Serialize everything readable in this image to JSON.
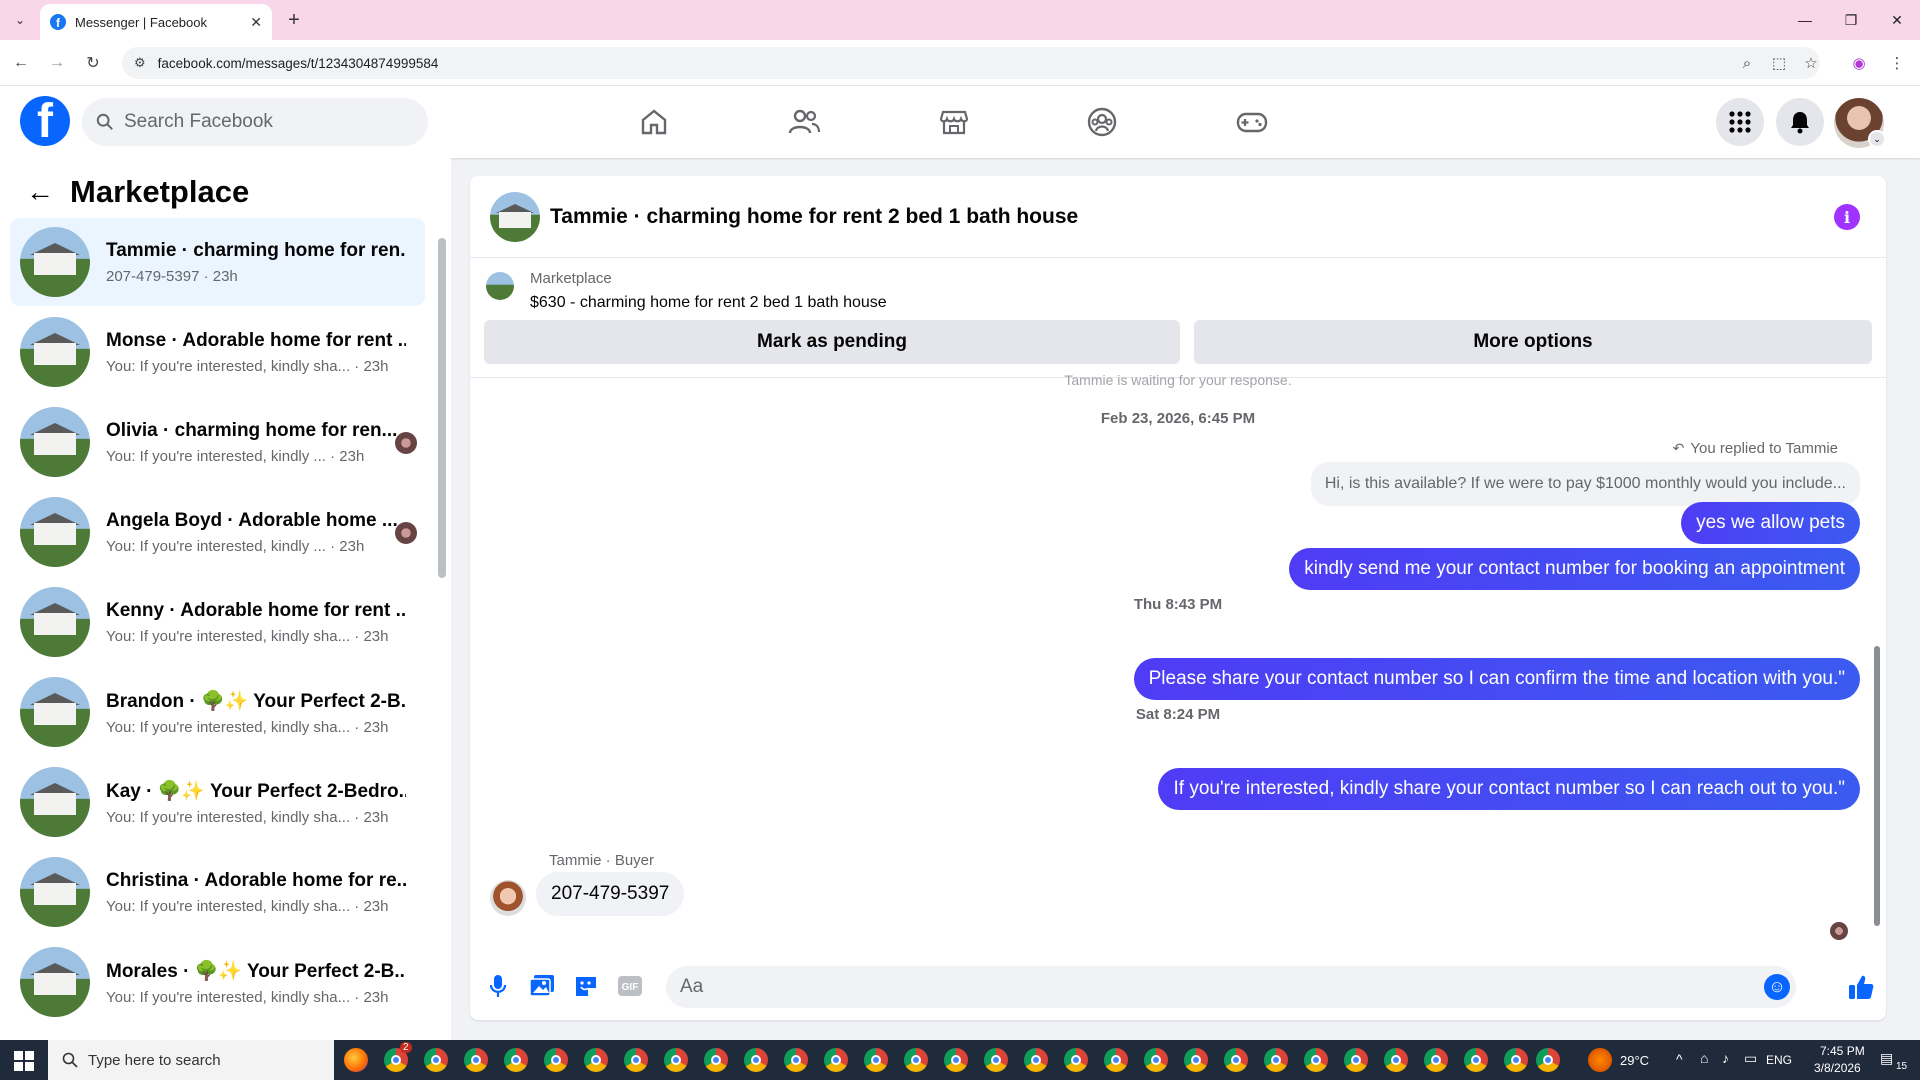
{
  "browser": {
    "tab_title": "Messenger | Facebook",
    "url": "facebook.com/messages/t/1234304874999584"
  },
  "fb": {
    "search_placeholder": "Search Facebook"
  },
  "left": {
    "title": "Marketplace",
    "conversations": [
      {
        "name": "Tammie · charming home for ren...",
        "preview": "207-479-5397 · 23h"
      },
      {
        "name": "Monse · Adorable home for rent ...",
        "preview": "You: If you're interested, kindly sha... · 23h"
      },
      {
        "name": "Olivia · charming home for ren...",
        "preview": "You: If you're interested, kindly ... · 23h"
      },
      {
        "name": "Angela Boyd · Adorable home ...",
        "preview": "You: If you're interested, kindly ... · 23h"
      },
      {
        "name": "Kenny · Adorable home for rent ...",
        "preview": "You: If you're interested, kindly sha... · 23h"
      },
      {
        "name": "Brandon · 🌳✨ Your Perfect 2-B...",
        "preview": "You: If you're interested, kindly sha... · 23h"
      },
      {
        "name": "Kay · 🌳✨ Your Perfect 2-Bedro...",
        "preview": "You: If you're interested, kindly sha... · 23h"
      },
      {
        "name": "Christina · Adorable home for re...",
        "preview": "You: If you're interested, kindly sha... · 23h"
      },
      {
        "name": "Morales · 🌳✨ Your Perfect 2-B...",
        "preview": "You: If you're interested, kindly sha... · 23h"
      }
    ]
  },
  "chat": {
    "title": "Tammie · charming home for rent 2 bed 1 bath house",
    "listing_source": "Marketplace",
    "listing_price": "$630 - charming home for rent 2 bed 1 bath house",
    "mark_pending": "Mark as pending",
    "more_options": "More options",
    "faded_notice": "Tammie is waiting for your response.",
    "ts1": "Feb 23, 2026, 6:45 PM",
    "reply_label": "You replied to Tammie",
    "quoted": "Hi, is this available? If we were to pay $1000 monthly would you include...",
    "msg1": "yes we allow pets",
    "msg2": "kindly send me your contact number for booking an appointment",
    "ts2": "Thu 8:43 PM",
    "msg3": "Please share your contact number so I can confirm the time and location with you.\"",
    "ts3": "Sat 8:24 PM",
    "msg4": "If you're interested, kindly share your contact number so I can reach out to you.\"",
    "buyer_label": "Tammie · Buyer",
    "incoming": "207-479-5397",
    "input_placeholder": "Aa"
  },
  "taskbar": {
    "search": "Type here to search",
    "temp": "29°C",
    "lang": "ENG",
    "time": "7:45 PM",
    "date": "3/8/2026",
    "notif_count": "15",
    "chrome_badge": "2"
  }
}
